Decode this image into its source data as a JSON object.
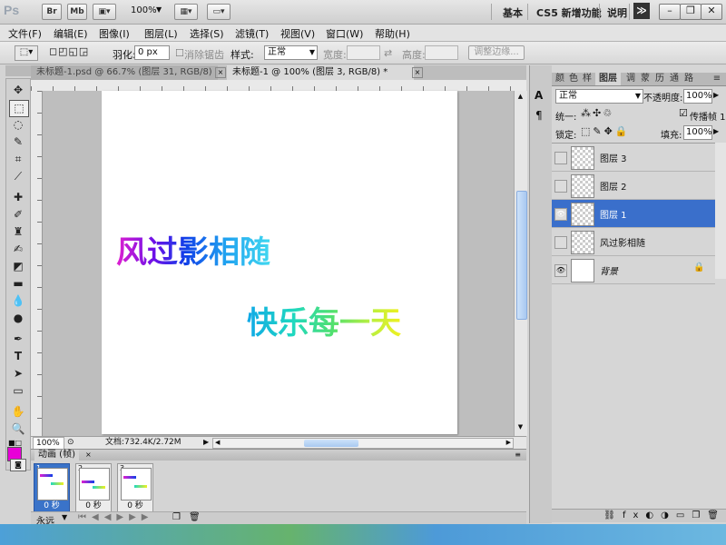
{
  "app": {
    "logo": "Ps",
    "bridge_btn": "Br",
    "minibridge_btn": "Mb",
    "zoom": "100%",
    "workspaces": [
      "基本",
      "CS5 新增功能",
      "说明"
    ],
    "more": "≫"
  },
  "menu": [
    "文件(F)",
    "编辑(E)",
    "图像(I)",
    "图层(L)",
    "选择(S)",
    "滤镜(T)",
    "视图(V)",
    "窗口(W)",
    "帮助(H)"
  ],
  "options": {
    "feather_label": "羽化:",
    "feather_value": "0 px",
    "antialias_label": "消除锯齿",
    "style_label": "样式:",
    "style_value": "正常",
    "width_label": "宽度:",
    "height_label": "高度:",
    "refine_edge": "调整边缘..."
  },
  "doc_tabs": [
    "未标题-1.psd @ 66.7% (图层 31, RGB/8) *",
    "未标题-1 @ 100% (图层 3, RGB/8) *"
  ],
  "canvas_text": {
    "line1": "风过影相随",
    "line2": "快乐每一天"
  },
  "status": {
    "zoom": "100%",
    "doc_size": "文档:732.4K/2.72M"
  },
  "animation": {
    "title": "动画 (帧)",
    "frames": [
      {
        "num": "1",
        "delay": "0 秒"
      },
      {
        "num": "2",
        "delay": "0 秒"
      },
      {
        "num": "3",
        "delay": "0 秒"
      }
    ],
    "loop": "永远"
  },
  "panel_tabs": [
    "颜",
    "色",
    "样",
    "图层",
    "调",
    "蒙",
    "历",
    "通",
    "路"
  ],
  "layers": {
    "blend_mode": "正常",
    "opacity_label": "不透明度:",
    "opacity_value": "100%",
    "unify_label": "统一:",
    "propagate_label": "传播帧 1",
    "lock_label": "锁定:",
    "fill_label": "填充:",
    "fill_value": "100%",
    "items": [
      {
        "name": "图层 3",
        "visible": false,
        "selected": false
      },
      {
        "name": "图层 2",
        "visible": false,
        "selected": false
      },
      {
        "name": "图层 1",
        "visible": true,
        "selected": true
      },
      {
        "name": "风过影相随",
        "visible": false,
        "selected": false
      },
      {
        "name": "背景",
        "visible": true,
        "selected": false
      }
    ]
  },
  "colors": {
    "foreground": "#e800d8",
    "background": "#ffffff",
    "selection": "#3a6fcb"
  }
}
